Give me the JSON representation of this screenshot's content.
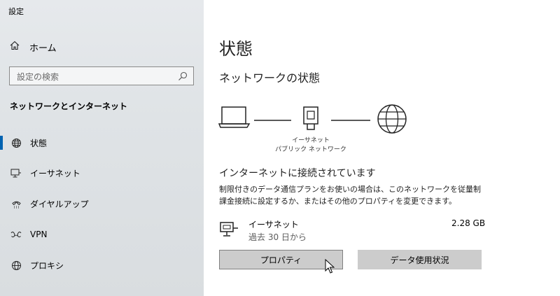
{
  "window": {
    "title": "設定"
  },
  "sidebar": {
    "home_label": "ホーム",
    "search_placeholder": "設定の検索",
    "section_title": "ネットワークとインターネット",
    "items": [
      {
        "label": "状態",
        "icon": "globe-network-icon",
        "active": true
      },
      {
        "label": "イーサネット",
        "icon": "ethernet-monitor-icon"
      },
      {
        "label": "ダイヤルアップ",
        "icon": "dialup-phone-icon"
      },
      {
        "label": "VPN",
        "icon": "vpn-icon"
      },
      {
        "label": "プロキシ",
        "icon": "globe-icon"
      }
    ]
  },
  "main": {
    "title": "状態",
    "subheading": "ネットワークの状態",
    "diagram": {
      "label_line1": "イーサネット",
      "label_line2": "パブリック ネットワーク"
    },
    "status_heading": "インターネットに接続されています",
    "status_description": "制限付きのデータ通信プランをお使いの場合は、このネットワークを従量制課金接続に設定するか、またはその他のプロパティを変更できます。",
    "adapter": {
      "name": "イーサネット",
      "period": "過去 30 日から",
      "usage": "2.28 GB"
    },
    "buttons": {
      "properties": "プロパティ",
      "data_usage": "データ使用状況"
    }
  },
  "colors": {
    "accent": "#0063b1",
    "sidebar_bg": "#e1e5e8",
    "button_bg": "#cccccc"
  }
}
